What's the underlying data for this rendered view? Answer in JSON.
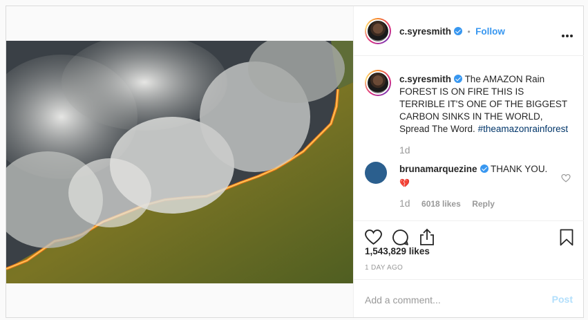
{
  "post": {
    "username": "c.syresmith",
    "verified": true,
    "follow_label": "Follow",
    "separator": "•",
    "caption": "The AMAZON Rain FOREST IS ON FIRE THIS IS TERRIBLE IT'S ONE OF THE BIGGEST CARBON SINKS IN THE WORLD, Spread The Word.",
    "hashtag": "#theamazonrainforest",
    "caption_age": "1d",
    "likes": "1,543,829 likes",
    "posted_ago": "1 DAY AGO"
  },
  "comments": [
    {
      "username": "brunamarquezine",
      "verified": true,
      "text": "THANK YOU.",
      "emoji": "💔",
      "age": "1d",
      "likes": "6018 likes",
      "reply_label": "Reply"
    }
  ],
  "comment_box": {
    "placeholder": "Add a comment...",
    "post_label": "Post"
  },
  "icons": {
    "more": "more-options-icon",
    "like": "heart-icon",
    "comment": "comment-icon",
    "share": "share-icon",
    "save": "bookmark-icon",
    "verified": "verified-badge-icon",
    "comment_like": "small-heart-icon"
  },
  "colors": {
    "accent": "#3897f0",
    "hashtag": "#003569",
    "muted": "#999999",
    "post_disabled": "#b2dffc",
    "commenter_avatar": "#2b5f8e"
  }
}
